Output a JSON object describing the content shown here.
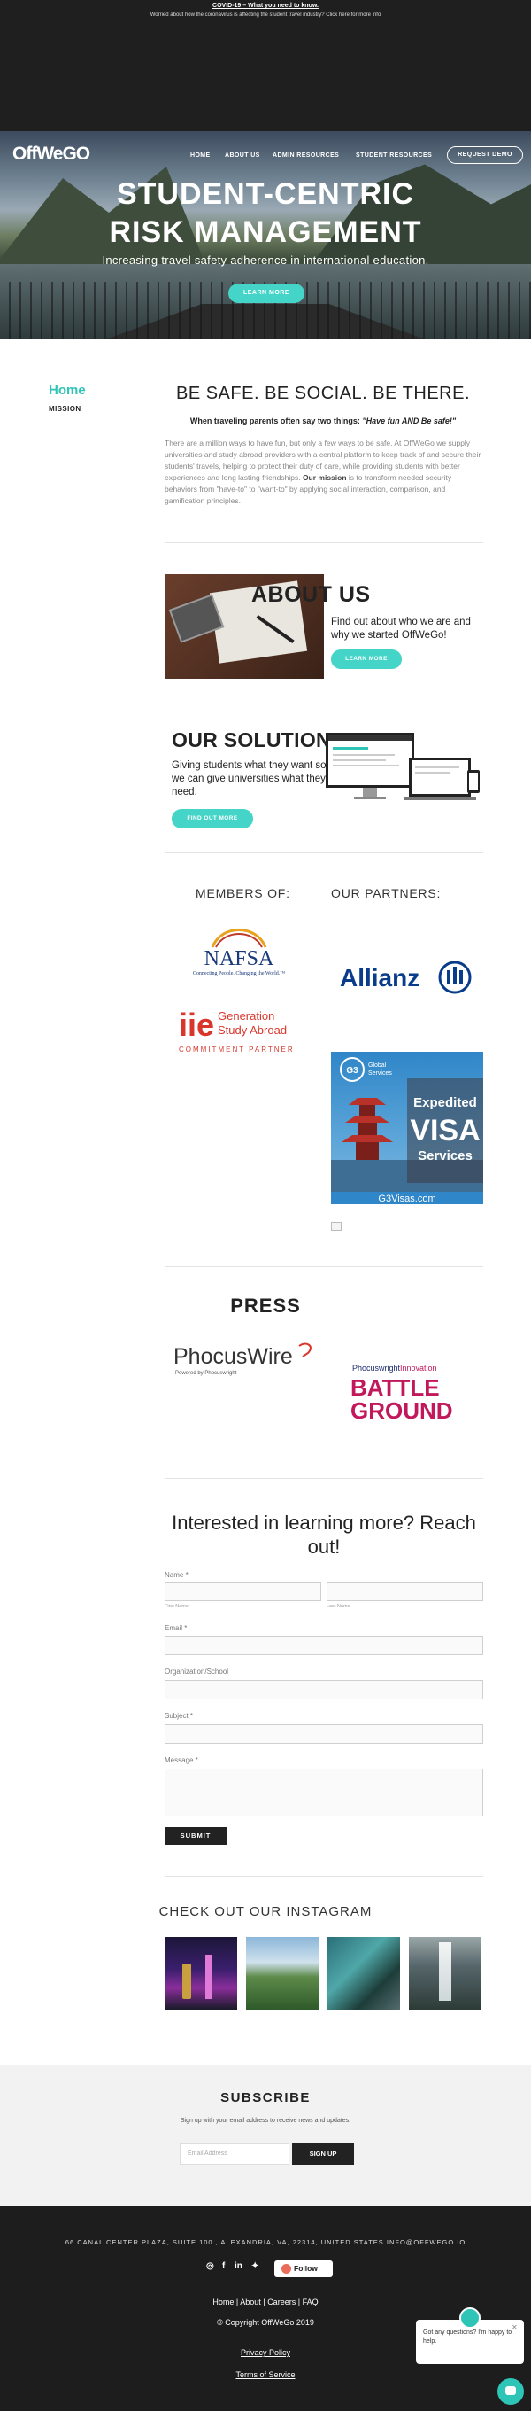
{
  "banner": {
    "title": "COVID-19 – What you need to know.",
    "subtitle": "Worried about how the coronavirus is affecting the student travel industry? Click here for more info"
  },
  "header": {
    "logo": "OffWeGO",
    "nav": [
      "HOME",
      "ABOUT US",
      "ADMIN RESOURCES",
      "STUDENT RESOURCES"
    ],
    "demo_label": "REQUEST DEMO"
  },
  "hero": {
    "title_line1": "STUDENT-CENTRIC",
    "title_line2": "RISK MANAGEMENT",
    "subtitle": "Increasing travel safety adherence in international education.",
    "cta": "LEARN MORE"
  },
  "mission": {
    "side_title": "Home",
    "side_sub": "MISSION",
    "heading": "BE SAFE. BE SOCIAL. BE THERE.",
    "parents_pre": "When traveling parents often say two things: ",
    "parents_quote": "\"Have fun AND Be safe!\"",
    "para_a": "There are a million ways to have fun, but only a few ways to be safe. At OffWeGo we supply universities and study abroad providers with a central platform to keep track of and secure their students' travels, helping to protect their duty of care, while providing students with better experiences and long lasting friendships. ",
    "para_bold": "Our mission",
    "para_b": " is to transform needed security behaviors from \"have-to\" to \"want-to\" by applying social interaction, comparison, and gamification principles."
  },
  "about": {
    "heading": "ABOUT US",
    "text": "Find out about who we are and why we started OffWeGo!",
    "cta": "LEARN MORE"
  },
  "solution": {
    "heading": "OUR SOLUTION",
    "text": "Giving students what they want so we can give universities what they need.",
    "cta": "FIND OUT MORE"
  },
  "members": {
    "heading": "MEMBERS OF:",
    "nafsa_name": "NAFSA",
    "nafsa_tag": "Connecting People. Changing the World.™",
    "iie_mark": "iie",
    "iie_line1": "Generation",
    "iie_line2": "Study Abroad",
    "iie_line3": "COMMITMENT PARTNER"
  },
  "partners": {
    "heading": "OUR PARTNERS:",
    "allianz": "Allianz",
    "g3_badge": "G3",
    "g3_brand_1": "Global",
    "g3_brand_2": "Services",
    "g3_line1": "Expedited",
    "g3_line2": "VISA",
    "g3_line3": "Services",
    "g3_url": "G3Visas.com"
  },
  "press": {
    "heading": "PRESS",
    "phocus_name": "PhocusWire",
    "phocus_sub": "Powered by Phocuswright",
    "bg_top_a": "Phocuswright",
    "bg_top_b": "Innovation",
    "bg_line1": "BATTLE",
    "bg_line2": "GROUND"
  },
  "contact": {
    "heading": "Interested in learning more? Reach out!",
    "name_label": "Name *",
    "first_name": "First Name",
    "last_name": "Last Name",
    "email_label": "Email *",
    "org_label": "Organization/School",
    "subject_label": "Subject *",
    "message_label": "Message *",
    "submit": "SUBMIT"
  },
  "instagram": {
    "heading": "CHECK OUT OUR INSTAGRAM"
  },
  "subscribe": {
    "heading": "SUBSCRIBE",
    "text": "Sign up with your email address to receive news and updates.",
    "placeholder": "Email Address",
    "button": "SIGN UP"
  },
  "footer": {
    "address": "66 CANAL CENTER PLAZA, SUITE 100 , ALEXANDRIA, VA, 22314, UNITED STATES   INFO@OFFWEGO.IO",
    "social_instagram": "◎",
    "social_facebook": "f",
    "social_linkedin": "in",
    "social_twitter": "✦",
    "follow": "Follow",
    "link_home": "Home",
    "link_about": "About",
    "link_careers": "Careers",
    "link_faq": "FAQ",
    "sep": "|",
    "copyright": "© Copyright OffWeGo 2019",
    "privacy": "Privacy Policy",
    "terms": "Terms of Service"
  },
  "chat": {
    "message": "Got any questions? I'm happy to help.",
    "close": "✕"
  },
  "colors": {
    "accent": "#45d4c8",
    "dark": "#1d1d1d"
  }
}
